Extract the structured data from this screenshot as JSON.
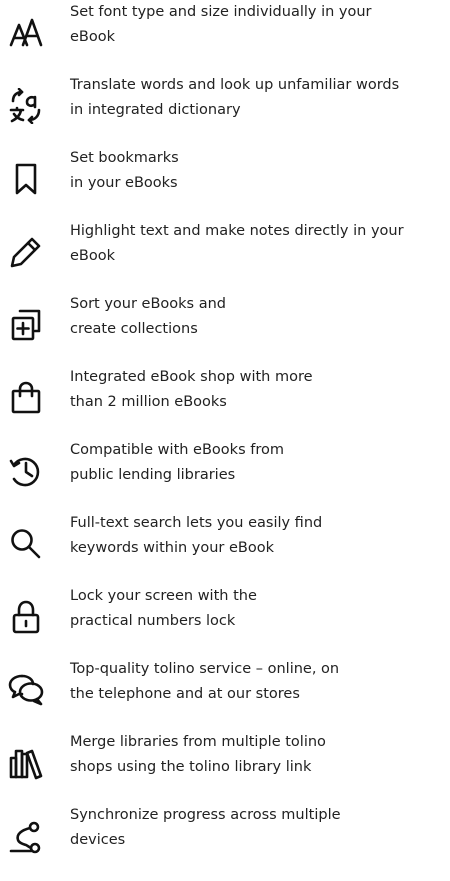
{
  "features": [
    {
      "icon": "font-size-icon",
      "line1": "Set font type and size individually in your",
      "line2": "eBook"
    },
    {
      "icon": "translate-icon",
      "line1": "Translate words and look up unfamiliar words",
      "line2": "in integrated dictionary"
    },
    {
      "icon": "bookmark-icon",
      "line1": "Set bookmarks",
      "line2": "in your eBooks"
    },
    {
      "icon": "pencil-icon",
      "line1": "Highlight text and make notes directly in your",
      "line2": "eBook"
    },
    {
      "icon": "collection-icon",
      "line1": "Sort your eBooks and",
      "line2": "create collections"
    },
    {
      "icon": "shopping-bag-icon",
      "line1": "Integrated eBook shop with more",
      "line2": "than 2 million eBooks"
    },
    {
      "icon": "history-clock-icon",
      "line1": "Compatible with eBooks from",
      "line2": "public lending libraries"
    },
    {
      "icon": "search-icon",
      "line1": "Full-text search lets you easily find",
      "line2": "keywords within your eBook"
    },
    {
      "icon": "lock-icon",
      "line1": "Lock your screen with the",
      "line2": "practical numbers lock"
    },
    {
      "icon": "chat-bubbles-icon",
      "line1": "Top-quality tolino service – online, on",
      "line2": "the telephone and at our stores"
    },
    {
      "icon": "library-books-icon",
      "line1": "Merge libraries from multiple tolino",
      "line2": "shops using the tolino library link"
    },
    {
      "icon": "sync-path-icon",
      "line1": "Synchronize progress across multiple",
      "line2": "devices"
    }
  ]
}
